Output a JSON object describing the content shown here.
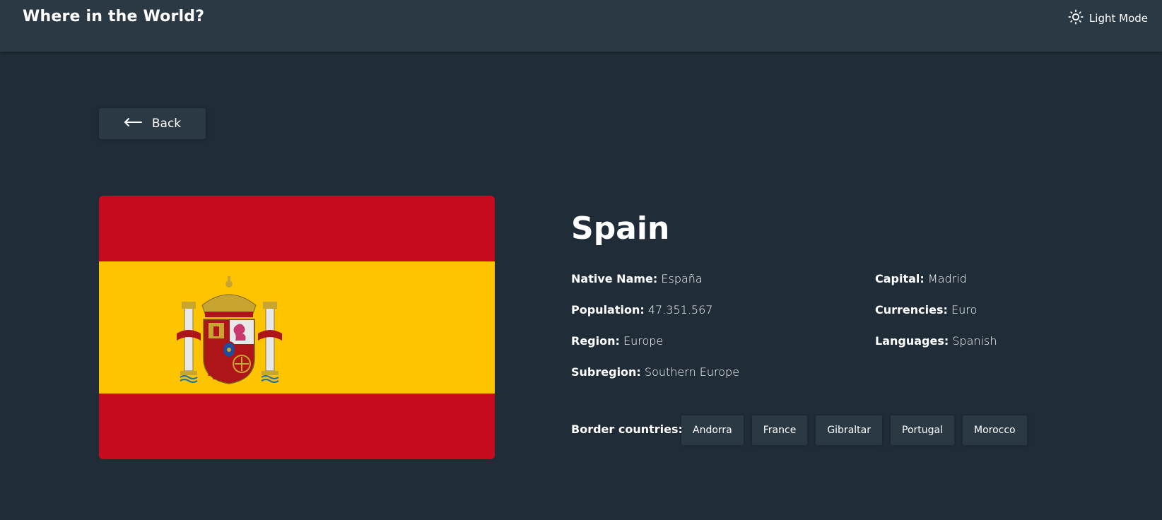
{
  "header": {
    "title": "Where in the World?",
    "theme_toggle": {
      "label": "Light Mode",
      "icon": "sun-icon"
    }
  },
  "back_button": {
    "label": "Back",
    "icon": "arrow-left-icon"
  },
  "country": {
    "name": "Spain",
    "flag": {
      "icon": "spain-flag",
      "colors": {
        "red": "#c60b1e",
        "yellow": "#ffc400"
      }
    },
    "details": {
      "native_name": {
        "label": "Native Name:",
        "value": "España"
      },
      "population": {
        "label": "Population:",
        "value": "47.351.567"
      },
      "region": {
        "label": "Region:",
        "value": "Europe"
      },
      "subregion": {
        "label": "Subregion:",
        "value": "Southern Europe"
      },
      "capital": {
        "label": "Capital:",
        "value": "Madrid"
      },
      "currencies": {
        "label": "Currencies:",
        "value": "Euro"
      },
      "languages": {
        "label": "Languages:",
        "value": "Spanish"
      }
    },
    "border_label": "Border countries:",
    "borders": [
      "Andorra",
      "France",
      "Gibraltar",
      "Portugal",
      "Morocco"
    ]
  },
  "colors": {
    "background": "#202c37",
    "elements": "#2b3945",
    "text": "#ffffff"
  }
}
